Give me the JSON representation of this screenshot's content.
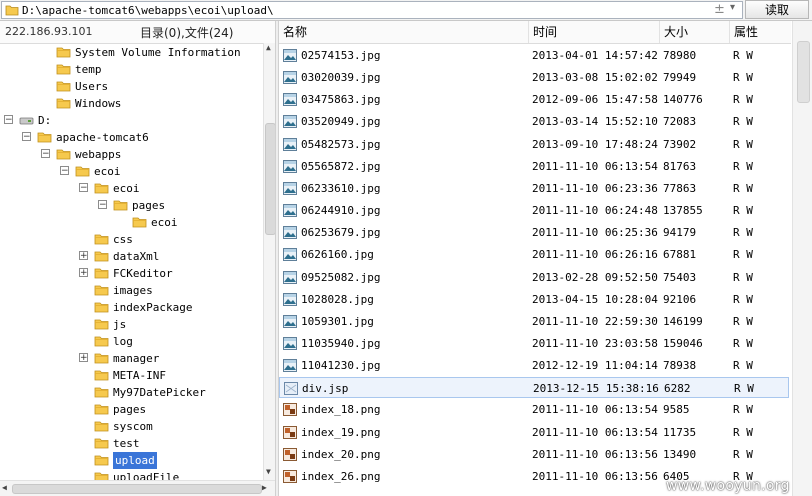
{
  "path_bar": {
    "path": "D:\\apache-tomcat6\\webapps\\ecoi\\upload\\",
    "plus_glyph": "±",
    "dropdown_glyph": "▾",
    "read_button": "读取"
  },
  "left_panel": {
    "ip": "222.186.93.101",
    "dir_count": "目录(0),文件(24)"
  },
  "tree": [
    {
      "label": "System Volume Information",
      "level": 2,
      "expander": "",
      "icon": "folder"
    },
    {
      "label": "temp",
      "level": 2,
      "expander": "",
      "icon": "folder"
    },
    {
      "label": "Users",
      "level": 2,
      "expander": "",
      "icon": "folder"
    },
    {
      "label": "Windows",
      "level": 2,
      "expander": "",
      "icon": "folder"
    },
    {
      "label": "D:",
      "level": 0,
      "expander": "−",
      "icon": "drive"
    },
    {
      "label": "apache-tomcat6",
      "level": 1,
      "expander": "−",
      "icon": "folder"
    },
    {
      "label": "webapps",
      "level": 2,
      "expander": "−",
      "icon": "folder"
    },
    {
      "label": "ecoi",
      "level": 3,
      "expander": "−",
      "icon": "folder"
    },
    {
      "label": "ecoi",
      "level": 4,
      "expander": "−",
      "icon": "folder"
    },
    {
      "label": "pages",
      "level": 5,
      "expander": "−",
      "icon": "folder"
    },
    {
      "label": "ecoi",
      "level": 6,
      "expander": "",
      "icon": "folder"
    },
    {
      "label": "css",
      "level": 4,
      "expander": "",
      "icon": "folder"
    },
    {
      "label": "dataXml",
      "level": 4,
      "expander": "+",
      "icon": "folder"
    },
    {
      "label": "FCKeditor",
      "level": 4,
      "expander": "+",
      "icon": "folder"
    },
    {
      "label": "images",
      "level": 4,
      "expander": "",
      "icon": "folder"
    },
    {
      "label": "indexPackage",
      "level": 4,
      "expander": "",
      "icon": "folder"
    },
    {
      "label": "js",
      "level": 4,
      "expander": "",
      "icon": "folder"
    },
    {
      "label": "log",
      "level": 4,
      "expander": "",
      "icon": "folder"
    },
    {
      "label": "manager",
      "level": 4,
      "expander": "+",
      "icon": "folder"
    },
    {
      "label": "META-INF",
      "level": 4,
      "expander": "",
      "icon": "folder"
    },
    {
      "label": "My97DatePicker",
      "level": 4,
      "expander": "",
      "icon": "folder"
    },
    {
      "label": "pages",
      "level": 4,
      "expander": "",
      "icon": "folder"
    },
    {
      "label": "syscom",
      "level": 4,
      "expander": "",
      "icon": "folder"
    },
    {
      "label": "test",
      "level": 4,
      "expander": "",
      "icon": "folder"
    },
    {
      "label": "upload",
      "level": 4,
      "expander": "",
      "icon": "folder",
      "selected": true
    },
    {
      "label": "uploadFile",
      "level": 4,
      "expander": "",
      "icon": "folder"
    }
  ],
  "columns": {
    "name": "名称",
    "time": "时间",
    "size": "大小",
    "attr": "属性"
  },
  "files": [
    {
      "name": "02574153.jpg",
      "time": "2013-04-01 14:57:42",
      "size": "78980",
      "attr": "R W",
      "type": "image"
    },
    {
      "name": "03020039.jpg",
      "time": "2013-03-08 15:02:02",
      "size": "79949",
      "attr": "R W",
      "type": "image"
    },
    {
      "name": "03475863.jpg",
      "time": "2012-09-06 15:47:58",
      "size": "140776",
      "attr": "R W",
      "type": "image"
    },
    {
      "name": "03520949.jpg",
      "time": "2013-03-14 15:52:10",
      "size": "72083",
      "attr": "R W",
      "type": "image"
    },
    {
      "name": "05482573.jpg",
      "time": "2013-09-10 17:48:24",
      "size": "73902",
      "attr": "R W",
      "type": "image"
    },
    {
      "name": "05565872.jpg",
      "time": "2011-11-10 06:13:54",
      "size": "81763",
      "attr": "R W",
      "type": "image"
    },
    {
      "name": "06233610.jpg",
      "time": "2011-11-10 06:23:36",
      "size": "77863",
      "attr": "R W",
      "type": "image"
    },
    {
      "name": "06244910.jpg",
      "time": "2011-11-10 06:24:48",
      "size": "137855",
      "attr": "R W",
      "type": "image"
    },
    {
      "name": "06253679.jpg",
      "time": "2011-11-10 06:25:36",
      "size": "94179",
      "attr": "R W",
      "type": "image"
    },
    {
      "name": "0626160.jpg",
      "time": "2011-11-10 06:26:16",
      "size": "67881",
      "attr": "R W",
      "type": "image"
    },
    {
      "name": "09525082.jpg",
      "time": "2013-02-28 09:52:50",
      "size": "75403",
      "attr": "R W",
      "type": "image"
    },
    {
      "name": "1028028.jpg",
      "time": "2013-04-15 10:28:04",
      "size": "92106",
      "attr": "R W",
      "type": "image"
    },
    {
      "name": "1059301.jpg",
      "time": "2011-11-10 22:59:30",
      "size": "146199",
      "attr": "R W",
      "type": "image"
    },
    {
      "name": "11035940.jpg",
      "time": "2011-11-10 23:03:58",
      "size": "159046",
      "attr": "R W",
      "type": "image"
    },
    {
      "name": "11041230.jpg",
      "time": "2012-12-19 11:04:14",
      "size": "78938",
      "attr": "R W",
      "type": "image"
    },
    {
      "name": "div.jsp",
      "time": "2013-12-15 15:38:16",
      "size": "6282",
      "attr": "R W",
      "type": "jsp",
      "highlighted": true
    },
    {
      "name": "index_18.png",
      "time": "2011-11-10 06:13:54",
      "size": "9585",
      "attr": "R W",
      "type": "png"
    },
    {
      "name": "index_19.png",
      "time": "2011-11-10 06:13:54",
      "size": "11735",
      "attr": "R W",
      "type": "png"
    },
    {
      "name": "index_20.png",
      "time": "2011-11-10 06:13:56",
      "size": "13490",
      "attr": "R W",
      "type": "png"
    },
    {
      "name": "index_26.png",
      "time": "2011-11-10 06:13:56",
      "size": "6405",
      "attr": "R W",
      "type": "png"
    }
  ],
  "watermark": "www.wooyun.org",
  "colors": {
    "selection": "#3a75d8",
    "folder": "#f6c94e",
    "row_highlight": "#edf3fc"
  }
}
